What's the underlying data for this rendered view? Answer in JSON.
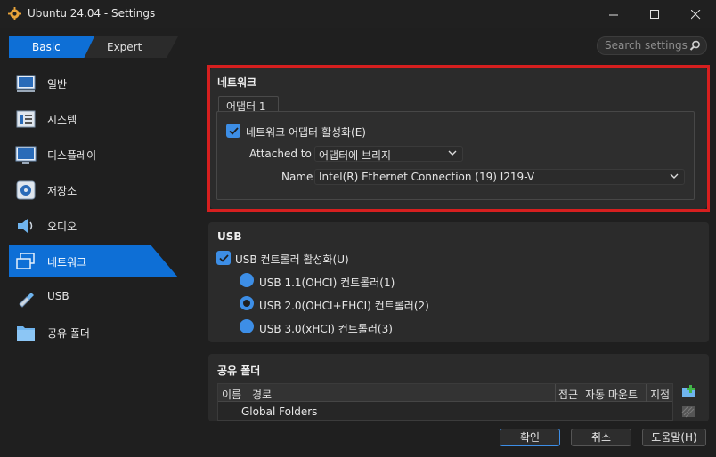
{
  "window": {
    "title": "Ubuntu 24.04 - Settings"
  },
  "mode": {
    "basic": "Basic",
    "expert": "Expert"
  },
  "search": {
    "placeholder": "Search settings"
  },
  "sidebar": {
    "items": [
      {
        "label": "일반",
        "icon": "general-icon"
      },
      {
        "label": "시스템",
        "icon": "system-icon"
      },
      {
        "label": "디스플레이",
        "icon": "display-icon"
      },
      {
        "label": "저장소",
        "icon": "storage-icon"
      },
      {
        "label": "오디오",
        "icon": "audio-icon"
      },
      {
        "label": "네트워크",
        "icon": "network-icon"
      },
      {
        "label": "USB",
        "icon": "usb-icon"
      },
      {
        "label": "공유 폴더",
        "icon": "folder-icon"
      }
    ],
    "active": "네트워크"
  },
  "network": {
    "title": "네트워크",
    "tab": "어댑터 1",
    "enable_label": "네트워크 어댑터 활성화(E)",
    "attached_label": "Attached to",
    "attached_value": "어댑터에 브리지",
    "name_label": "Name",
    "name_value": "Intel(R) Ethernet Connection (19) I219-V"
  },
  "usb": {
    "title": "USB",
    "enable_label": "USB 컨트롤러 활성화(U)",
    "options": [
      "USB 1.1(OHCI) 컨트롤러(1)",
      "USB 2.0(OHCI+EHCI) 컨트롤러(2)",
      "USB 3.0(xHCI) 컨트롤러(3)"
    ],
    "selected_index": 1
  },
  "shared": {
    "title": "공유 폴더",
    "columns": [
      "이름",
      "경로",
      "접근",
      "자동 마운트",
      "지점"
    ],
    "rows": [
      "Global Folders"
    ]
  },
  "buttons": {
    "ok": "확인",
    "cancel": "취소",
    "help": "도움말(H)"
  },
  "colors": {
    "accent": "#0e6fd6",
    "highlight_border": "#d61f1f",
    "background": "#1f1f1f",
    "panel": "#2b2b2b"
  }
}
